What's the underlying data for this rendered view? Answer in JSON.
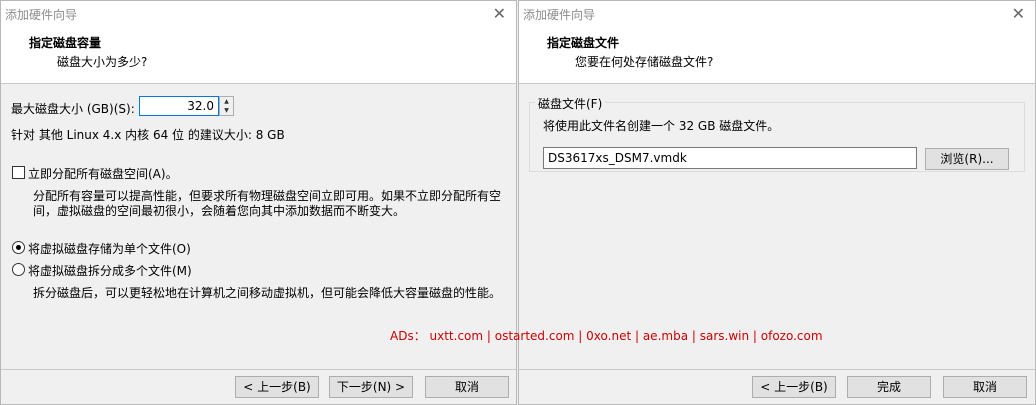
{
  "left": {
    "title": "添加硬件向导",
    "header_title": "指定磁盘容量",
    "header_subtitle": "磁盘大小为多少?",
    "max_size_label": "最大磁盘大小 (GB)(S):",
    "max_size_value": "32.0",
    "recommended": "针对 其他 Linux 4.x 内核 64 位 的建议大小: 8 GB",
    "allocate_label": "立即分配所有磁盘空间(A)。",
    "allocate_checked": false,
    "allocate_desc_1": "分配所有容量可以提高性能，但要求所有物理磁盘空间立即可用。如果不立即分配所有空",
    "allocate_desc_2": "间，虚拟磁盘的空间最初很小，会随着您向其中添加数据而不断变大。",
    "single_file_label": "将虚拟磁盘存储为单个文件(O)",
    "multi_file_label": "将虚拟磁盘拆分成多个文件(M)",
    "multi_file_desc": "拆分磁盘后，可以更轻松地在计算机之间移动虚拟机，但可能会降低大容量磁盘的性能。",
    "selected_option": "single",
    "back_button": "< 上一步(B)",
    "next_button": "下一步(N) >",
    "cancel_button": "取消"
  },
  "right": {
    "title": "添加硬件向导",
    "header_title": "指定磁盘文件",
    "header_subtitle": "您要在何处存储磁盘文件?",
    "group_label": "磁盘文件(F)",
    "group_desc": "将使用此文件名创建一个 32 GB 磁盘文件。",
    "file_value": "DS3617xs_DSM7.vmdk",
    "browse_button": "浏览(R)...",
    "back_button": "< 上一步(B)",
    "finish_button": "完成",
    "cancel_button": "取消"
  },
  "ads": "ADs： uxtt.com | ostarted.com | 0xo.net | ae.mba | sars.win | ofozo.com"
}
